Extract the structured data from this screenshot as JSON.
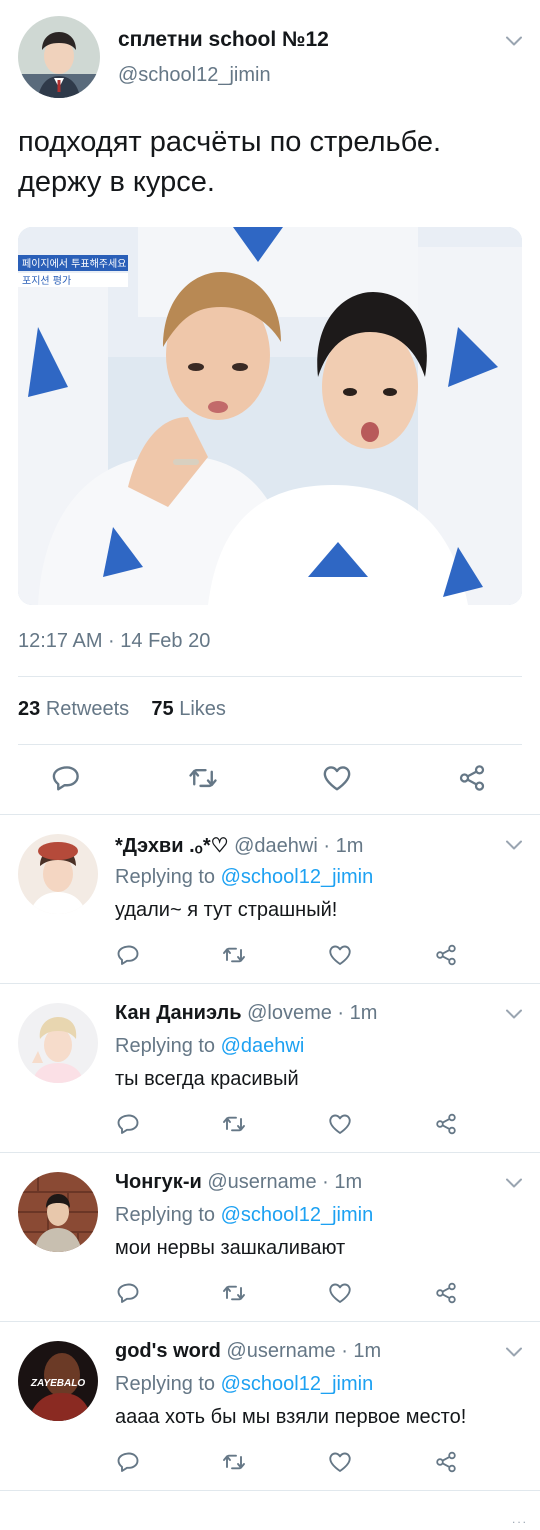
{
  "main_tweet": {
    "display_name": "сплетни school №12",
    "handle": "@school12_jimin",
    "text": "подходят расчёты по стрельбе.\nдержу в курсе.",
    "photo_caption_lines": [
      "페이지에서 투표해주세요",
      "포지션 평가"
    ],
    "timestamp": "12:17 AM · 14 Feb 20",
    "retweets_count": "23",
    "retweets_label": "Retweets",
    "likes_count": "75",
    "likes_label": "Likes"
  },
  "replies": [
    {
      "name": "*Дэхви .ₒ*♡",
      "handle": "@daehwi · 1m",
      "replying_label": "Replying to",
      "replying_to": "@school12_jimin",
      "text": "удали~ я тут страшный!"
    },
    {
      "name": "Кан Даниэль",
      "handle": "@loveme · 1m",
      "replying_label": "Replying to",
      "replying_to": "@daehwi",
      "text": "ты всегда красивый"
    },
    {
      "name": "Чонгук-и",
      "handle": "@username · 1m",
      "replying_label": "Replying to",
      "replying_to": "@school12_jimin",
      "text": "мои нервы зашкаливают"
    },
    {
      "name": "god's word",
      "handle": "@username · 1m",
      "replying_label": "Replying to",
      "replying_to": "@school12_jimin",
      "text": "аааа хоть бы мы взяли первое место!",
      "avatar_text": "ZAYEBALO"
    }
  ],
  "footer_ellipsis": "...",
  "colors": {
    "text": "#14171a",
    "secondary": "#657786",
    "link": "#1da1f2",
    "divider": "#e1e8ed"
  },
  "icons": [
    "reply-icon",
    "retweet-icon",
    "like-icon",
    "share-icon",
    "chevron-down-icon"
  ]
}
